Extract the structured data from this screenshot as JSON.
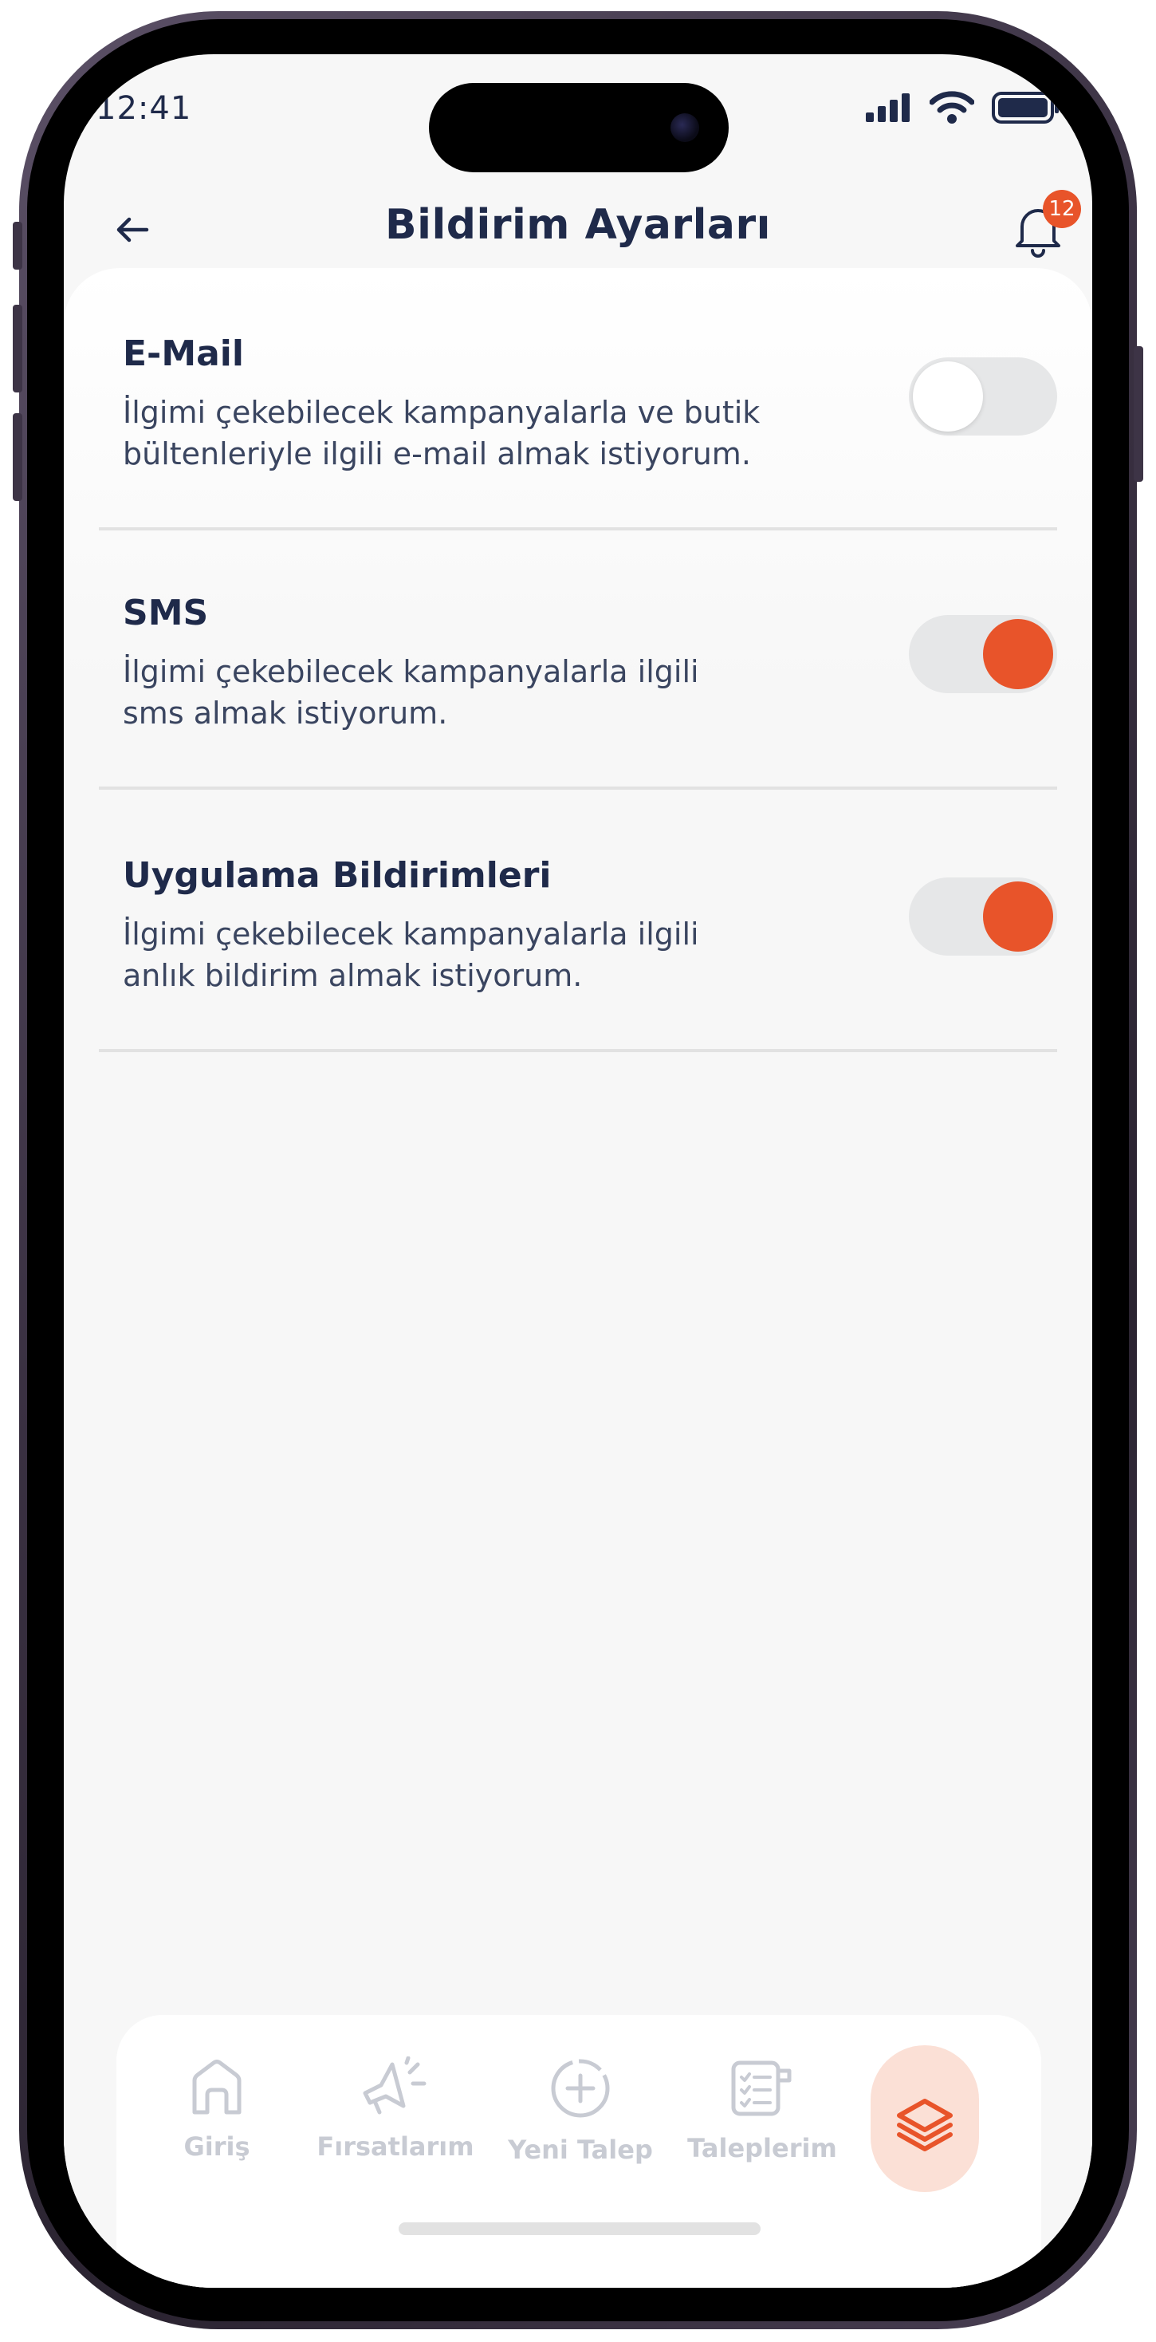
{
  "status_bar": {
    "time": "12:41"
  },
  "header": {
    "title": "Bildirim Ayarları",
    "notification_count": "12"
  },
  "settings": [
    {
      "title": "E-Mail",
      "description_lines": [
        "İlgimi çekebilecek kampanyalarla ve butik",
        "bültenleriyle ilgili e-mail almak istiyorum."
      ],
      "enabled": false
    },
    {
      "title": "SMS",
      "description_lines": [
        "İlgimi çekebilecek kampanyalarla ilgili",
        "sms almak istiyorum."
      ],
      "enabled": true
    },
    {
      "title": "Uygulama Bildirimleri",
      "description_lines": [
        "İlgimi çekebilecek kampanyalarla ilgili",
        "anlık bildirim almak istiyorum."
      ],
      "enabled": true
    }
  ],
  "tab_bar": {
    "tabs": [
      {
        "label": "Giriş",
        "icon": "home-icon"
      },
      {
        "label": "Fırsatlarım",
        "icon": "megaphone-icon"
      },
      {
        "label": "Yeni Talep",
        "icon": "plus-circle-icon"
      },
      {
        "label": "Taleplerim",
        "icon": "checklist-icon"
      },
      {
        "label": "",
        "icon": "layers-icon",
        "active": true
      }
    ]
  },
  "colors": {
    "accent": "#e8542a",
    "title_text": "#1f2a4a",
    "inactive_tab": "#c8cbd3",
    "toggle_track": "#e6e7e8"
  }
}
